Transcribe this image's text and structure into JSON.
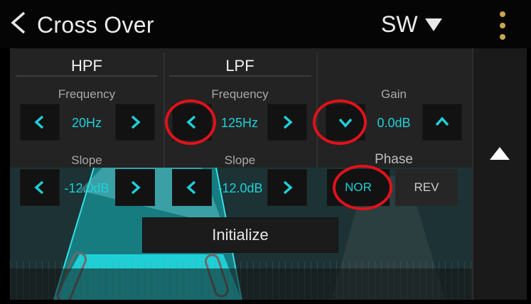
{
  "header": {
    "title": "Cross Over",
    "channel": "SW",
    "back_icon": "chevron-left-icon",
    "menu_icon": "kebab-menu-icon"
  },
  "hpf": {
    "heading": "HPF",
    "frequency_label": "Frequency",
    "frequency_value": "20Hz",
    "slope_label": "Slope",
    "slope_value": "-12.0dB"
  },
  "lpf": {
    "heading": "LPF",
    "frequency_label": "Frequency",
    "frequency_value": "125Hz",
    "slope_label": "Slope",
    "slope_value": "-12.0dB"
  },
  "gain": {
    "label": "Gain",
    "value": "0.0dB"
  },
  "phase": {
    "label": "Phase",
    "options": [
      "NOR",
      "REV"
    ],
    "selected": "NOR"
  },
  "actions": {
    "initialize": "Initialize"
  },
  "colors": {
    "accent": "#1fd0d8",
    "header_dots": "#c9a64e",
    "highlight_circle": "#e0121b"
  }
}
